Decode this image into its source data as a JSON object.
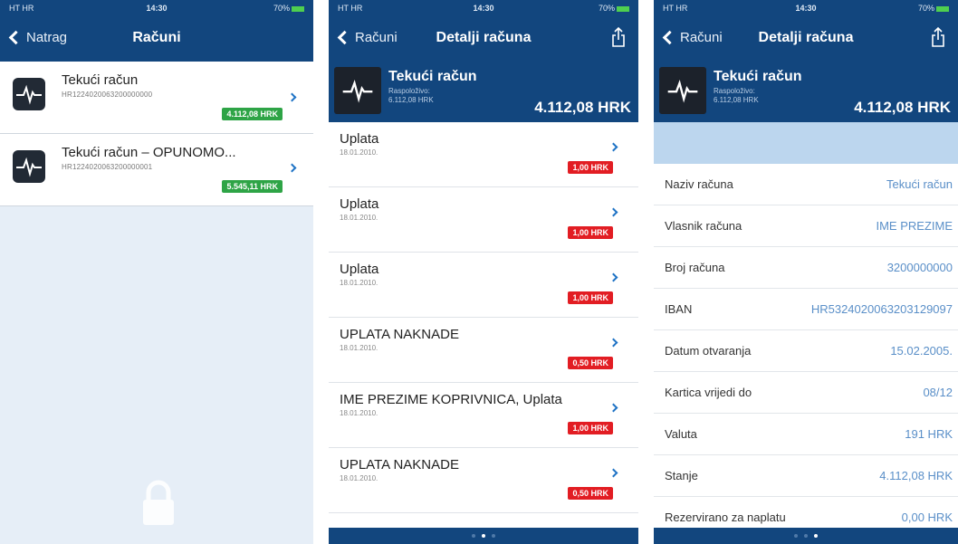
{
  "status_bar": {
    "carrier": "HT HR",
    "time": "14:30",
    "battery": "70%"
  },
  "colors": {
    "brand": "#12467e",
    "positive": "#2ea446",
    "negative": "#e21d23",
    "link": "#1f73c5"
  },
  "screen1": {
    "nav": {
      "back": "Natrag",
      "title": "Računi"
    },
    "accounts": [
      {
        "name": "Tekući račun",
        "iban": "HR1224020063200000000",
        "amount": "4.112,08 HRK"
      },
      {
        "name": "Tekući račun – OPUNOMO...",
        "iban": "HR1224020063200000001",
        "amount": "5.545,11 HRK"
      }
    ]
  },
  "screen2": {
    "nav": {
      "back": "Računi",
      "title": "Detalji računa"
    },
    "header": {
      "name": "Tekući račun",
      "avail_label": "Raspoloživo:",
      "avail_value": "6.112,08 HRK",
      "balance": "4.112,08 HRK"
    },
    "transactions": [
      {
        "name": "Uplata",
        "date": "18.01.2010.",
        "amount": "1,00 HRK"
      },
      {
        "name": "Uplata",
        "date": "18.01.2010.",
        "amount": "1,00 HRK"
      },
      {
        "name": "Uplata",
        "date": "18.01.2010.",
        "amount": "1,00 HRK"
      },
      {
        "name": "UPLATA NAKNADE",
        "date": "18.01.2010.",
        "amount": "0,50 HRK"
      },
      {
        "name": "IME PREZIME KOPRIVNICA, Uplata",
        "date": "18.01.2010.",
        "amount": "1,00 HRK"
      },
      {
        "name": "UPLATA NAKNADE",
        "date": "18.01.2010.",
        "amount": "0,50 HRK"
      }
    ],
    "page_index": 1
  },
  "screen3": {
    "nav": {
      "back": "Računi",
      "title": "Detalji računa"
    },
    "header": {
      "name": "Tekući račun",
      "avail_label": "Raspoloživo:",
      "avail_value": "6.112,08 HRK",
      "balance": "4.112,08 HRK"
    },
    "details": [
      {
        "label": "Naziv računa",
        "value": "Tekući račun"
      },
      {
        "label": "Vlasnik računa",
        "value": "IME PREZIME"
      },
      {
        "label": "Broj računa",
        "value": "3200000000"
      },
      {
        "label": "IBAN",
        "value": "HR5324020063203129097"
      },
      {
        "label": "Datum otvaranja",
        "value": "15.02.2005."
      },
      {
        "label": "Kartica vrijedi do",
        "value": "08/12"
      },
      {
        "label": "Valuta",
        "value": "191 HRK"
      },
      {
        "label": "Stanje",
        "value": "4.112,08 HRK"
      },
      {
        "label": "Rezervirano za naplatu",
        "value": "0,00 HRK"
      }
    ],
    "page_index": 2
  }
}
